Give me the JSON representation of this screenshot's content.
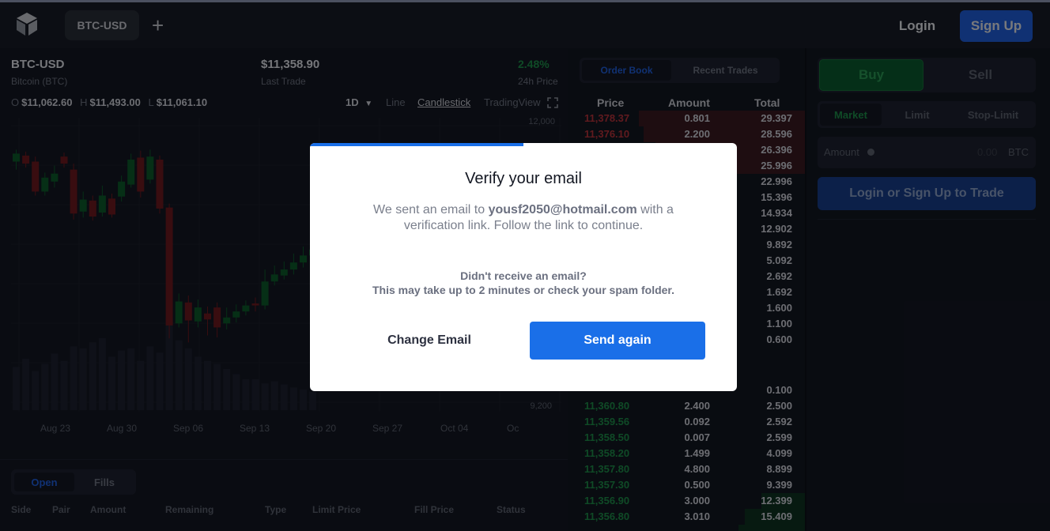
{
  "header": {
    "pair_tab": "BTC-USD",
    "add_icon": "plus-icon",
    "login_label": "Login",
    "signup_label": "Sign Up"
  },
  "market": {
    "pair": "BTC-USD",
    "name": "Bitcoin (BTC)",
    "last_price": "$11,358.90",
    "last_label": "Last Trade",
    "change_pct": "2.48%",
    "change_label": "24h Price",
    "ohl": [
      {
        "k": "O",
        "v": "$11,062.60"
      },
      {
        "k": "H",
        "v": "$11,493.00"
      },
      {
        "k": "L",
        "v": "$11,061.10"
      }
    ],
    "timeframe": "1D",
    "chart_types": [
      "Line",
      "Candlestick",
      "TradingView"
    ],
    "active_chart_type": "Candlestick"
  },
  "chart_data": {
    "type": "candlestick",
    "title": "",
    "xlabel": "",
    "ylabel": "",
    "y_tick_labels": [
      "12,000",
      "9,200"
    ],
    "x_tick_labels": [
      "Aug 23",
      "Aug 30",
      "Sep 06",
      "Sep 13",
      "Sep 20",
      "Sep 27",
      "Oct 04",
      "Oc"
    ],
    "ylim": [
      9200,
      12000
    ],
    "candles": [
      {
        "o": 11640,
        "c": 11720,
        "h": 11760,
        "l": 11560
      },
      {
        "o": 11700,
        "c": 11620,
        "h": 11740,
        "l": 11580
      },
      {
        "o": 11640,
        "c": 11340,
        "h": 11690,
        "l": 11300
      },
      {
        "o": 11340,
        "c": 11480,
        "h": 11530,
        "l": 11300
      },
      {
        "o": 11440,
        "c": 11520,
        "h": 11600,
        "l": 11380
      },
      {
        "o": 11690,
        "c": 11620,
        "h": 11730,
        "l": 11580
      },
      {
        "o": 11560,
        "c": 11120,
        "h": 11620,
        "l": 11060
      },
      {
        "o": 11140,
        "c": 11260,
        "h": 11340,
        "l": 11080
      },
      {
        "o": 11250,
        "c": 11090,
        "h": 11300,
        "l": 11050
      },
      {
        "o": 11130,
        "c": 11300,
        "h": 11400,
        "l": 11090
      },
      {
        "o": 11270,
        "c": 11110,
        "h": 11320,
        "l": 11080
      },
      {
        "o": 11290,
        "c": 11440,
        "h": 11500,
        "l": 11240
      },
      {
        "o": 11410,
        "c": 11660,
        "h": 11720,
        "l": 11380
      },
      {
        "o": 11680,
        "c": 11340,
        "h": 11750,
        "l": 11280
      },
      {
        "o": 11460,
        "c": 11690,
        "h": 11760,
        "l": 11420
      },
      {
        "o": 11660,
        "c": 11170,
        "h": 11700,
        "l": 11120
      },
      {
        "o": 11180,
        "c": 10000,
        "h": 11220,
        "l": 9870
      },
      {
        "o": 10020,
        "c": 10240,
        "h": 10320,
        "l": 9980
      },
      {
        "o": 10230,
        "c": 10050,
        "h": 10300,
        "l": 9830
      },
      {
        "o": 10040,
        "c": 10180,
        "h": 10260,
        "l": 9980
      },
      {
        "o": 10120,
        "c": 10060,
        "h": 10190,
        "l": 9900
      },
      {
        "o": 10180,
        "c": 9980,
        "h": 10230,
        "l": 9880
      },
      {
        "o": 10020,
        "c": 10080,
        "h": 10180,
        "l": 9960
      },
      {
        "o": 10080,
        "c": 10140,
        "h": 10210,
        "l": 10030
      },
      {
        "o": 10140,
        "c": 10200,
        "h": 10250,
        "l": 10100
      },
      {
        "o": 10220,
        "c": 10200,
        "h": 10280,
        "l": 10140
      },
      {
        "o": 10200,
        "c": 10440,
        "h": 10560,
        "l": 10160
      },
      {
        "o": 10440,
        "c": 10510,
        "h": 10600,
        "l": 10400
      },
      {
        "o": 10500,
        "c": 10560,
        "h": 10640,
        "l": 10460
      },
      {
        "o": 10560,
        "c": 10630,
        "h": 10720,
        "l": 10510
      },
      {
        "o": 10630,
        "c": 10700,
        "h": 10790,
        "l": 10580
      },
      {
        "o": 10700,
        "c": 10760,
        "h": 10840,
        "l": 10640
      }
    ],
    "volumes": [
      0.42,
      0.5,
      0.38,
      0.45,
      0.55,
      0.48,
      0.62,
      0.6,
      0.66,
      0.7,
      0.52,
      0.58,
      0.6,
      0.48,
      0.62,
      0.56,
      0.9,
      0.68,
      0.6,
      0.52,
      0.48,
      0.45,
      0.4,
      0.35,
      0.3,
      0.3,
      0.26,
      0.28,
      0.25,
      0.22,
      0.2,
      0.18
    ]
  },
  "orders": {
    "tabs": [
      "Open",
      "Fills"
    ],
    "columns": [
      "Side",
      "Pair",
      "Amount",
      "Remaining",
      "Type",
      "Limit Price",
      "Fill Price",
      "Status"
    ]
  },
  "book": {
    "tabs": [
      "Order Book",
      "Recent Trades"
    ],
    "headers": [
      "Price",
      "Amount",
      "Total"
    ],
    "asks": [
      {
        "p": "11,378.37",
        "a": "0.801",
        "t": "29.397",
        "d": 1.0
      },
      {
        "p": "11,376.10",
        "a": "2.200",
        "t": "28.596",
        "d": 0.97
      },
      {
        "p": "",
        "a": "",
        "t": "26.396",
        "d": 0.9
      },
      {
        "p": "",
        "a": "",
        "t": "25.996",
        "d": 0.88
      },
      {
        "p": "",
        "a": "",
        "t": "22.996",
        "d": 0.0
      },
      {
        "p": "",
        "a": "",
        "t": "15.396",
        "d": 0.0
      },
      {
        "p": "",
        "a": "",
        "t": "14.934",
        "d": 0.0
      },
      {
        "p": "",
        "a": "",
        "t": "12.902",
        "d": 0.0
      },
      {
        "p": "",
        "a": "",
        "t": "9.892",
        "d": 0.0
      },
      {
        "p": "",
        "a": "",
        "t": "5.092",
        "d": 0.0
      },
      {
        "p": "",
        "a": "",
        "t": "2.692",
        "d": 0.0
      },
      {
        "p": "",
        "a": "",
        "t": "1.692",
        "d": 0.0
      },
      {
        "p": "",
        "a": "",
        "t": "1.600",
        "d": 0.0
      },
      {
        "p": "",
        "a": "",
        "t": "1.100",
        "d": 0.0
      },
      {
        "p": "",
        "a": "",
        "t": "0.600",
        "d": 0.0
      }
    ],
    "bids": [
      {
        "p": "",
        "a": "",
        "t": "0.100",
        "d": 0.0
      },
      {
        "p": "11,360.80",
        "a": "2.400",
        "t": "2.500",
        "d": 0.0
      },
      {
        "p": "11,359.56",
        "a": "0.092",
        "t": "2.592",
        "d": 0.0
      },
      {
        "p": "11,358.50",
        "a": "0.007",
        "t": "2.599",
        "d": 0.0
      },
      {
        "p": "11,358.20",
        "a": "1.499",
        "t": "4.099",
        "d": 0.0
      },
      {
        "p": "11,357.80",
        "a": "4.800",
        "t": "8.899",
        "d": 0.0
      },
      {
        "p": "11,357.30",
        "a": "0.500",
        "t": "9.399",
        "d": 0.0
      },
      {
        "p": "11,356.90",
        "a": "3.000",
        "t": "12.399",
        "d": 0.26
      },
      {
        "p": "11,356.80",
        "a": "3.010",
        "t": "15.409",
        "d": 0.36
      },
      {
        "p": "",
        "a": "",
        "t": "",
        "d": 0.4
      }
    ]
  },
  "trade": {
    "buy_label": "Buy",
    "sell_label": "Sell",
    "order_types": [
      "Market",
      "Limit",
      "Stop-Limit"
    ],
    "amount_label": "Amount",
    "amount_value": "0.00",
    "amount_currency": "BTC",
    "cta_label": "Login or Sign Up to Trade"
  },
  "modal": {
    "title": "Verify your email",
    "body_prefix": "We sent an email to ",
    "email": "yousf2050@hotmail.com",
    "body_suffix": " with a verification link. Follow the link to continue.",
    "question": "Didn't receive an email?",
    "hint": "This may take up to 2 minutes or check your spam folder.",
    "change_label": "Change Email",
    "send_label": "Send again",
    "progress": 0.5,
    "accent": "#1a6fe8"
  }
}
